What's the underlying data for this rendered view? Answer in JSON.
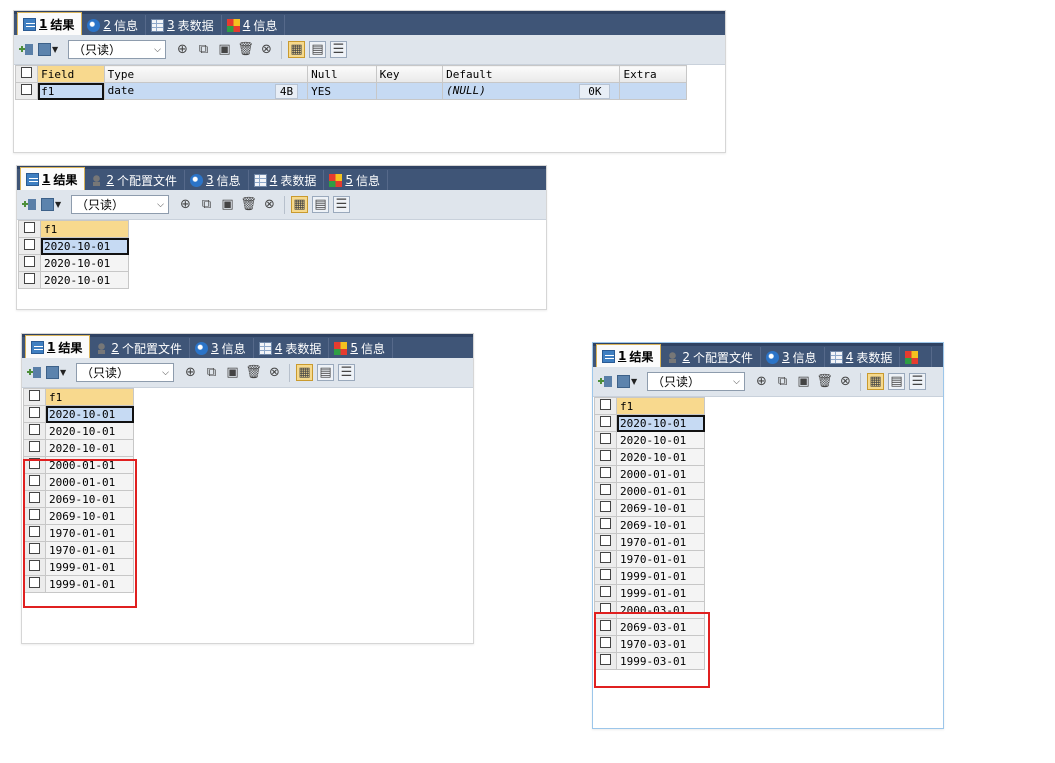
{
  "panel1": {
    "tabs": [
      {
        "num": "1",
        "label": "结果",
        "icon": "result-icon",
        "active": true
      },
      {
        "num": "2",
        "label": "信息",
        "icon": "info-icon"
      },
      {
        "num": "3",
        "label": "表数据",
        "icon": "table-icon"
      },
      {
        "num": "4",
        "label": "信息",
        "icon": "chart-icon"
      }
    ],
    "readonly": "（只读）",
    "columns": [
      "Field",
      "Type",
      "Null",
      "Key",
      "Default",
      "Extra"
    ],
    "row": {
      "field": "f1",
      "type": "date",
      "type_size": "4B",
      "null": "YES",
      "key": "",
      "default": "(NULL)",
      "default_size": "0K",
      "extra": ""
    }
  },
  "panel2": {
    "tabs": [
      {
        "num": "1",
        "label": "结果",
        "icon": "result-icon",
        "active": true
      },
      {
        "num": "2",
        "label": "个配置文件",
        "icon": "profile-icon"
      },
      {
        "num": "3",
        "label": "信息",
        "icon": "info-icon"
      },
      {
        "num": "4",
        "label": "表数据",
        "icon": "table-icon"
      },
      {
        "num": "5",
        "label": "信息",
        "icon": "chart-icon"
      }
    ],
    "readonly": "（只读）",
    "column": "f1",
    "rows": [
      "2020-10-01",
      "2020-10-01",
      "2020-10-01"
    ]
  },
  "panel3": {
    "tabs": [
      {
        "num": "1",
        "label": "结果",
        "icon": "result-icon",
        "active": true
      },
      {
        "num": "2",
        "label": "个配置文件",
        "icon": "profile-icon"
      },
      {
        "num": "3",
        "label": "信息",
        "icon": "info-icon"
      },
      {
        "num": "4",
        "label": "表数据",
        "icon": "table-icon"
      },
      {
        "num": "5",
        "label": "信息",
        "icon": "chart-icon"
      }
    ],
    "readonly": "（只读）",
    "column": "f1",
    "rows": [
      "2020-10-01",
      "2020-10-01",
      "2020-10-01",
      "2000-01-01",
      "2000-01-01",
      "2069-10-01",
      "2069-10-01",
      "1970-01-01",
      "1970-01-01",
      "1999-01-01",
      "1999-01-01"
    ]
  },
  "panel4": {
    "tabs": [
      {
        "num": "1",
        "label": "结果",
        "icon": "result-icon",
        "active": true
      },
      {
        "num": "2",
        "label": "个配置文件",
        "icon": "profile-icon"
      },
      {
        "num": "3",
        "label": "信息",
        "icon": "info-icon"
      },
      {
        "num": "4",
        "label": "表数据",
        "icon": "table-icon"
      },
      {
        "num": "",
        "label": "",
        "icon": "chart-icon"
      }
    ],
    "readonly": "（只读）",
    "column": "f1",
    "rows": [
      "2020-10-01",
      "2020-10-01",
      "2020-10-01",
      "2000-01-01",
      "2000-01-01",
      "2069-10-01",
      "2069-10-01",
      "1970-01-01",
      "1970-01-01",
      "1999-01-01",
      "1999-01-01",
      "2000-03-01",
      "2069-03-01",
      "1970-03-01",
      "1999-03-01"
    ]
  }
}
